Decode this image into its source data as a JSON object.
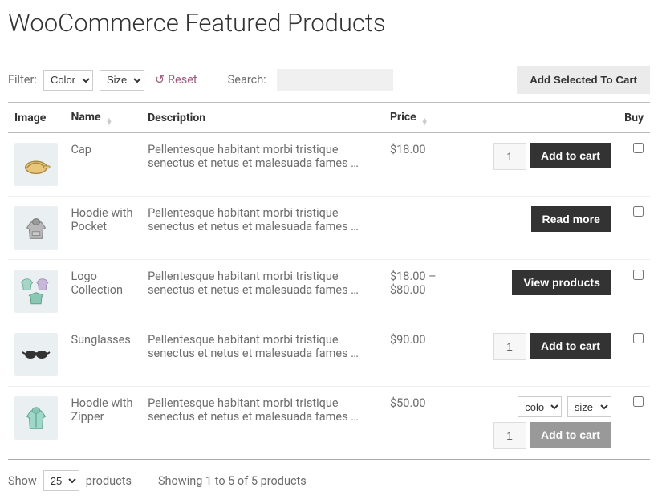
{
  "page_title": "WooCommerce Featured Products",
  "filter": {
    "label": "Filter:",
    "color_select": "Color",
    "size_select": "Size",
    "reset": "Reset",
    "search_label": "Search:"
  },
  "add_selected": "Add Selected To Cart",
  "columns": {
    "image": "Image",
    "name": "Name",
    "description": "Description",
    "price": "Price",
    "buy": "Buy"
  },
  "rows": [
    {
      "name": "Cap",
      "desc": "Pellentesque habitant morbi tristique senectus et netus et malesuada fames …",
      "price": "$18.00",
      "qty": "1",
      "action": "Add to cart",
      "action_type": "add"
    },
    {
      "name": "Hoodie with Pocket",
      "desc": "Pellentesque habitant morbi tristique senectus et netus et malesuada fames …",
      "price": "",
      "action": "Read more",
      "action_type": "read"
    },
    {
      "name": "Logo Collection",
      "desc": "Pellentesque habitant morbi tristique senectus et netus et malesuada fames …",
      "price": "$18.00 – $80.00",
      "action": "View products",
      "action_type": "view"
    },
    {
      "name": "Sunglasses",
      "desc": "Pellentesque habitant morbi tristique senectus et netus et malesuada fames …",
      "price": "$90.00",
      "qty": "1",
      "action": "Add to cart",
      "action_type": "add"
    },
    {
      "name": "Hoodie with Zipper",
      "desc": "Pellentesque habitant morbi tristique senectus et netus et malesuada fames …",
      "price": "$50.00",
      "qty": "1",
      "variations": {
        "color": "color",
        "size": "size"
      },
      "action": "Add to cart",
      "action_type": "add-disabled"
    }
  ],
  "footer": {
    "show": "Show",
    "pagesize": "25",
    "products": "products",
    "showing": "Showing 1 to 5 of 5 products"
  }
}
